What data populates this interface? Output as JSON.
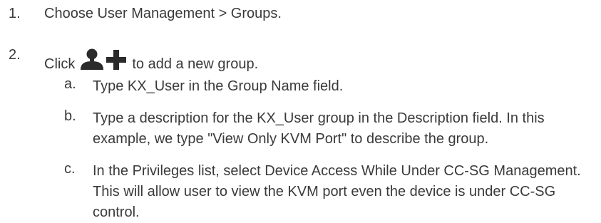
{
  "steps": [
    {
      "number": "1.",
      "text": "Choose User Management > Groups."
    },
    {
      "number": "2.",
      "text_before": "Click",
      "icon": "add-user-icon",
      "text_after": "to add a new group.",
      "substeps": [
        {
          "letter": "a.",
          "text": "Type KX_User in the Group Name field."
        },
        {
          "letter": "b.",
          "text": "Type a description for the KX_User group in the Description field. In this example, we type \"View Only KVM Port\" to describe the group."
        },
        {
          "letter": "c.",
          "text": "In the Privileges list, select Device Access While Under CC-SG Management. This will allow user to view the KVM port even the device is under CC-SG control."
        }
      ]
    }
  ],
  "colors": {
    "text": "#3a3a3a",
    "icon": "#2b2b2b"
  }
}
